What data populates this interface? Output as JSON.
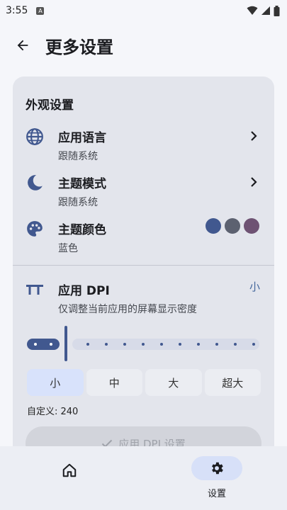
{
  "status_bar": {
    "time": "3:55",
    "app_badge": "A",
    "icons": [
      "wifi-icon",
      "signal-icon",
      "battery-icon"
    ]
  },
  "header": {
    "title": "更多设置",
    "back_icon": "arrow-left-icon"
  },
  "appearance": {
    "section_title": "外观设置",
    "language": {
      "title": "应用语言",
      "subtitle": "跟随系统",
      "icon": "globe-icon"
    },
    "theme_mode": {
      "title": "主题模式",
      "subtitle": "跟随系统",
      "icon": "moon-icon"
    },
    "theme_color": {
      "title": "主题颜色",
      "subtitle": "蓝色",
      "icon": "palette-icon",
      "swatches": [
        "#41588f",
        "#5c6170",
        "#6e5273"
      ]
    }
  },
  "dpi": {
    "title": "应用 DPI",
    "subtitle": "仅调整当前应用的屏幕显示密度",
    "current_label": "小",
    "icon": "text-size-icon",
    "slider_steps": 11,
    "slider_position": 0,
    "options": [
      "小",
      "中",
      "大",
      "超大"
    ],
    "selected_option": "小",
    "custom_label": "自定义: 240",
    "apply_label": "应用 DPI 设置"
  },
  "bottom_nav": {
    "home_icon": "home-icon",
    "settings_icon": "gear-icon",
    "settings_label": "设置"
  },
  "colors": {
    "accent": "#41588f",
    "card_bg": "#e3e5ec",
    "nav_selected": "#d7e0f8"
  }
}
